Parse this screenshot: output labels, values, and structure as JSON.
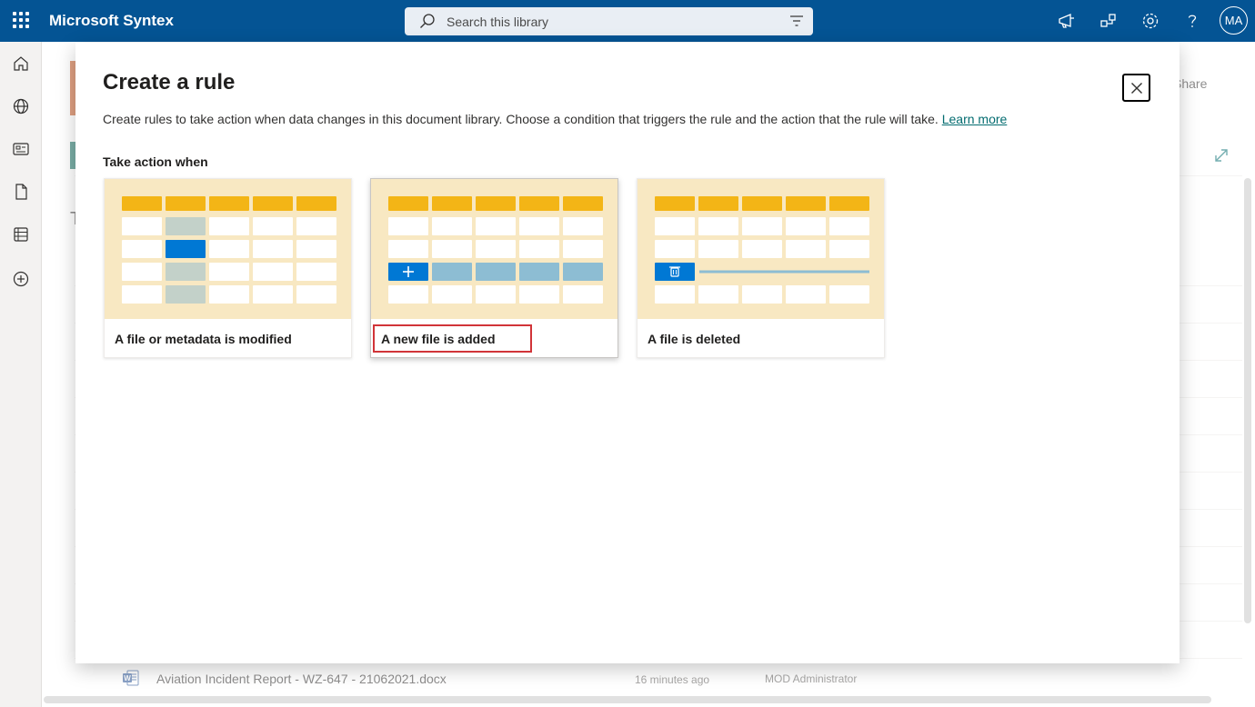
{
  "suite": {
    "app_title": "Microsoft Syntex",
    "search_placeholder": "Search this library",
    "avatar_initials": "MA"
  },
  "background": {
    "share_label": "Share",
    "title_fragment": "T",
    "file_row": {
      "name": "Aviation Incident Report - WZ-647 - 21062021.docx",
      "modified": "16 minutes ago",
      "modified_by": "MOD Administrator"
    }
  },
  "dialog": {
    "title": "Create a rule",
    "description": "Create rules to take action when data changes in this document library. Choose a condition that triggers the rule and the action that the rule will take.",
    "learn_more": "Learn more",
    "section_label": "Take action when",
    "options": [
      {
        "label": "A file or metadata is modified"
      },
      {
        "label": "A new file is added"
      },
      {
        "label": "A file is deleted"
      }
    ]
  },
  "colors": {
    "suite_bar": "#045494",
    "illustration_bg": "#f8e8c2",
    "header_cell": "#f3b516",
    "accent_blue": "#0078d4",
    "highlight_red": "#d13438",
    "link": "#036c70"
  }
}
